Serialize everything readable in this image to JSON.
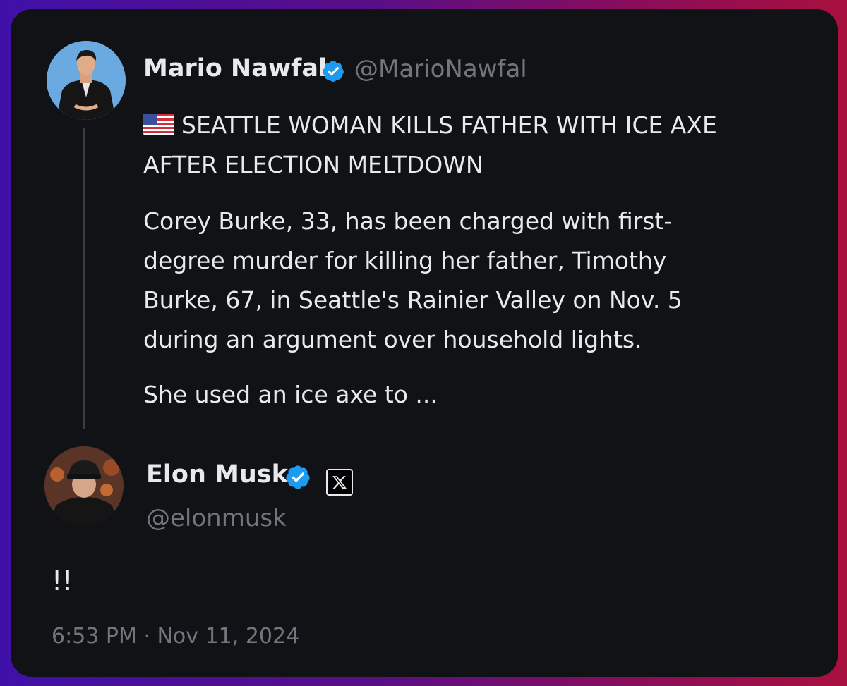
{
  "original_tweet": {
    "author_name": "Mario Nawfal",
    "author_handle": "@MarioNawfal",
    "verified_icon": "verified-badge-icon",
    "flag_icon": "us-flag-icon",
    "headline": "SEATTLE WOMAN KILLS FATHER WITH ICE AXE AFTER ELECTION MELTDOWN",
    "paragraph_1": "Corey Burke, 33, has been charged with first-degree murder for killing her father, Timothy Burke, 67, in Seattle's Rainier Valley on Nov. 5 during an argument over household lights.",
    "paragraph_2": "She used an ice axe to ..."
  },
  "reply_tweet": {
    "author_name": "Elon Musk",
    "author_handle": "@elonmusk",
    "verified_icon": "verified-badge-icon",
    "affiliation_icon": "x-logo-icon",
    "text": "!!",
    "timestamp": "6:53 PM · Nov 11, 2024"
  },
  "colors": {
    "card_background": "#101216",
    "primary_text": "#e7e9ea",
    "secondary_text": "#71767b",
    "verified_blue": "#1d9bf0"
  }
}
